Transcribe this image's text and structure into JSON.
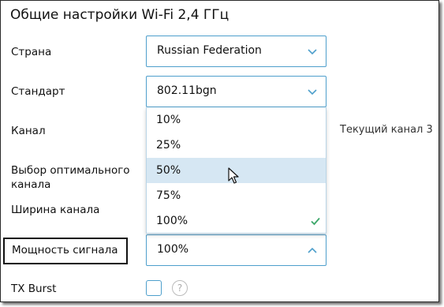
{
  "title": "Общие настройки Wi-Fi 2,4 ГГц",
  "fields": {
    "country": {
      "label": "Страна",
      "value": "Russian Federation"
    },
    "standard": {
      "label": "Стандарт",
      "value": "802.11bgn"
    },
    "channel": {
      "label": "Канал",
      "current": "Текущий канал 3"
    },
    "optimal": {
      "label": "Выбор оптимального канала"
    },
    "width": {
      "label": "Ширина канала"
    },
    "power": {
      "label": "Мощность сигнала",
      "value": "100%"
    },
    "txburst": {
      "label": "TX Burst",
      "help": "?"
    }
  },
  "dropdown": {
    "options": [
      "10%",
      "25%",
      "50%",
      "75%",
      "100%"
    ],
    "hovered": "50%",
    "selected": "100%"
  },
  "colors": {
    "accent_border": "#4e9fcc",
    "hover_bg": "#d6e7f3",
    "check": "#3ea86b"
  },
  "icons": {
    "chevron_down": "chevron-down-icon",
    "chevron_up": "chevron-up-icon",
    "check": "check-icon",
    "cursor": "pointer-cursor-icon",
    "help": "help-icon"
  }
}
